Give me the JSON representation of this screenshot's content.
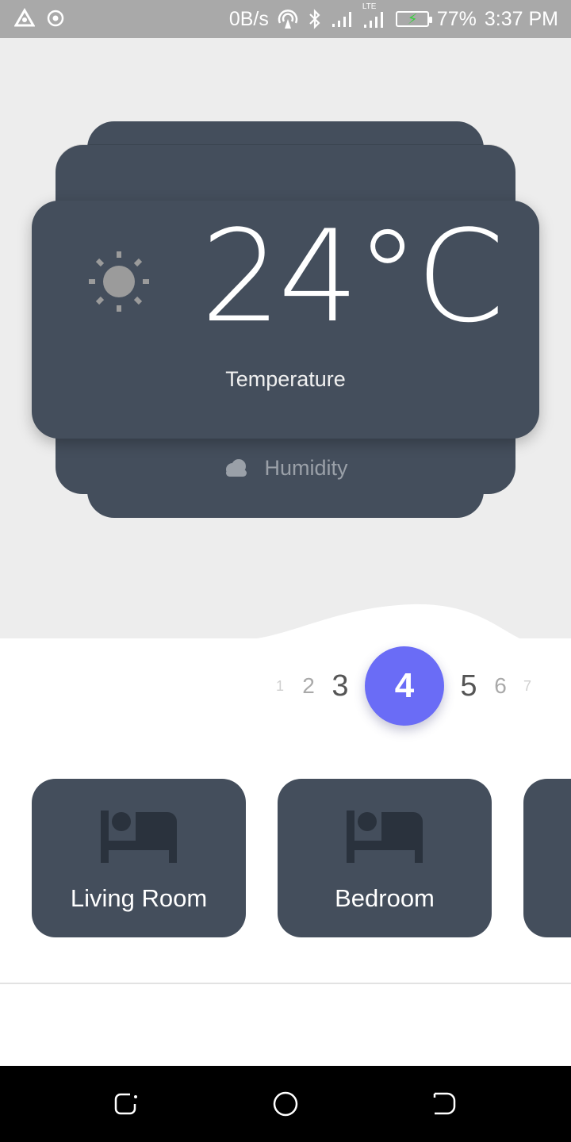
{
  "status_bar": {
    "net_speed": "0B/s",
    "network_type": "LTE",
    "battery": "77%",
    "time": "3:37 PM",
    "icons": [
      "alert-triangle-icon",
      "target-icon",
      "hotspot-icon",
      "bluetooth-icon",
      "signal-icon",
      "signal-lte-icon",
      "battery-charging-icon"
    ]
  },
  "climate": {
    "temperature_value": "24°C",
    "temperature_label": "Temperature",
    "humidity_label": "Humidity"
  },
  "pager": {
    "pages": [
      "1",
      "2",
      "3",
      "4",
      "5",
      "6",
      "7"
    ],
    "active": "4"
  },
  "rooms": [
    {
      "label": "Living Room",
      "icon": "bed-icon"
    },
    {
      "label": "Bedroom",
      "icon": "bed-icon"
    },
    {
      "label": "",
      "icon": ""
    }
  ],
  "colors": {
    "card": "#444e5c",
    "accent": "#6a6cf6",
    "background": "#ededed",
    "status_bar": "#a9a9a9"
  }
}
